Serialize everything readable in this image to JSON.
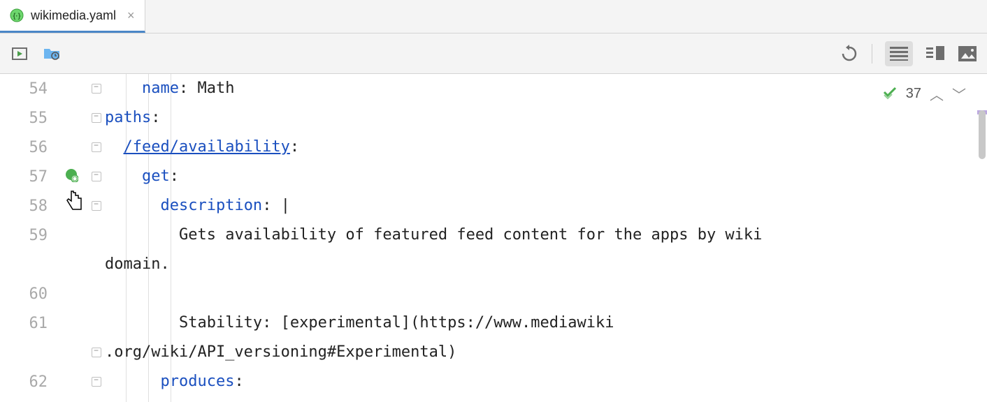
{
  "tab": {
    "filename": "wikimedia.yaml"
  },
  "toolbar": {},
  "inspection": {
    "count": "37"
  },
  "lines": [
    {
      "num": "54"
    },
    {
      "num": "55"
    },
    {
      "num": "56"
    },
    {
      "num": "57"
    },
    {
      "num": "58"
    },
    {
      "num": "59"
    },
    {
      "num": ""
    },
    {
      "num": "60"
    },
    {
      "num": "61"
    },
    {
      "num": ""
    },
    {
      "num": "62"
    }
  ],
  "code": {
    "l54_indent": "    ",
    "l54_key": "name",
    "l54_colon": ": ",
    "l54_val": "Math",
    "l55_key": "paths",
    "l55_colon": ":",
    "l56_indent": "  ",
    "l56_path": "/feed/availability",
    "l56_colon": ":",
    "l57_indent": "    ",
    "l57_key": "get",
    "l57_colon": ":",
    "l58_indent": "      ",
    "l58_key": "description",
    "l58_colon": ": ",
    "l58_pipe": "|",
    "l59_indent": "        ",
    "l59_text": "Gets availability of featured feed content for the apps by wiki",
    "l59b_text": "domain.",
    "l60_text": "",
    "l61_indent": "        ",
    "l61_text": "Stability: [experimental](https://www.mediawiki",
    "l61b_text": ".org/wiki/API_versioning#Experimental)",
    "l62_indent": "      ",
    "l62_key": "produces",
    "l62_colon": ":"
  }
}
